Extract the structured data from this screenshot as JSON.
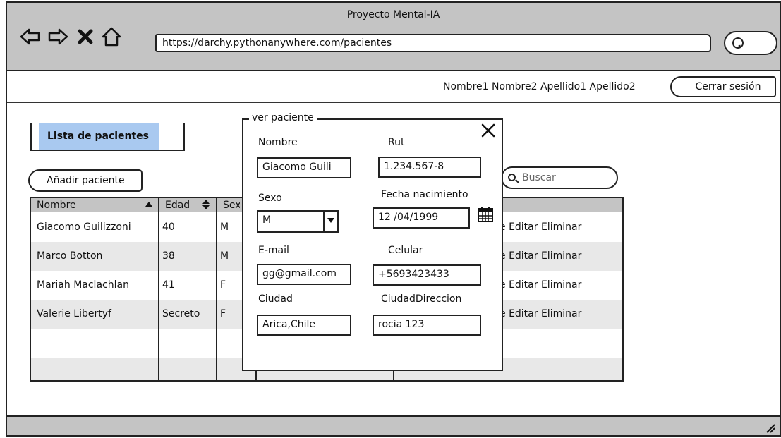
{
  "window": {
    "title": "Proyecto Mental-IA",
    "url": "https://darchy.pythonanywhere.com/pacientes"
  },
  "header": {
    "user_name": "Nombre1 Nombre2 Apellido1 Apellido2",
    "logout_label": "Cerrar sesión"
  },
  "content": {
    "list_tab_label": "Lista de pacientes",
    "add_button_label": "Añadir paciente",
    "search_placeholder": "Buscar"
  },
  "table": {
    "columns": [
      "Nombre",
      "Edad",
      "Sexo"
    ],
    "rows": [
      {
        "name": "Giacomo Guilizzoni",
        "age": "40",
        "sex": "M",
        "actions": "e Editar Eliminar"
      },
      {
        "name": "Marco Botton",
        "age": "38",
        "sex": "M",
        "actions": "e Editar Eliminar"
      },
      {
        "name": "Mariah Maclachlan",
        "age": "41",
        "sex": "F",
        "actions": "e Editar Eliminar"
      },
      {
        "name": "Valerie Libertyf",
        "age": "Secreto",
        "sex": "F",
        "actions": "e Editar Eliminar"
      }
    ]
  },
  "modal": {
    "legend": "ver paciente",
    "fields": {
      "nombre": {
        "label": "Nombre",
        "value": "Giacomo Guili"
      },
      "rut": {
        "label": "Rut",
        "value": "1.234.567-8"
      },
      "sexo": {
        "label": "Sexo",
        "value": "M"
      },
      "fecha": {
        "label": "Fecha nacimiento",
        "value": "12 /04/1999"
      },
      "email": {
        "label": "E-mail",
        "value": "gg@gmail.com"
      },
      "celular": {
        "label": "Celular",
        "value": "+5693423433"
      },
      "ciudad": {
        "label": "Ciudad",
        "value": "Arica,Chile"
      },
      "direccion": {
        "label": "CiudadDireccion",
        "value": "rocia 123"
      }
    }
  },
  "icons": {
    "back": "back-arrow-icon",
    "forward": "forward-arrow-icon",
    "stop": "close-x-icon",
    "home": "home-icon",
    "search": "search-icon",
    "close": "close-icon",
    "calendar": "calendar-icon"
  },
  "colors": {
    "chrome": "#c4c4c4",
    "tab_highlight": "#a9c9f0",
    "row_alt": "#e8e8e8"
  }
}
